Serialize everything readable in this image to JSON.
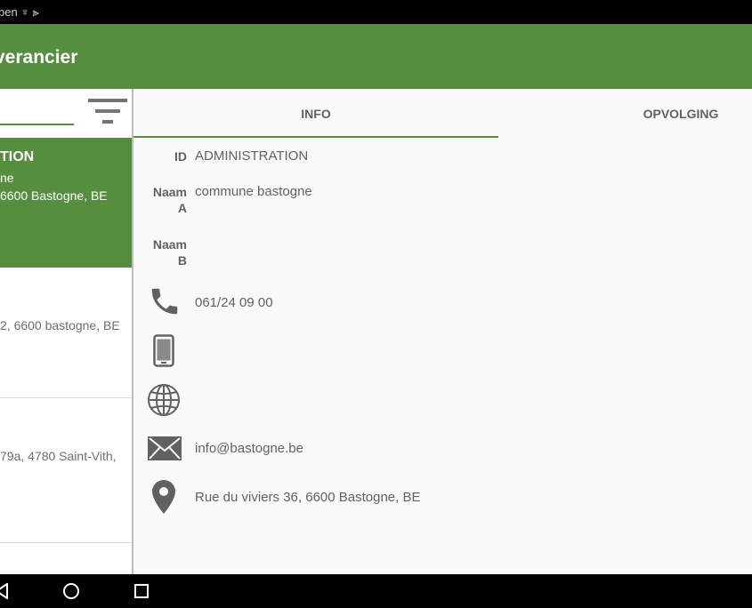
{
  "statusbar": {
    "text": "pen ♆ ⫸"
  },
  "appbar": {
    "title": "verancier"
  },
  "list": {
    "selected": {
      "title": "TION",
      "line2": "ne",
      "line3": "6600 Bastogne, BE"
    },
    "item2": {
      "line": "2, 6600 bastogne, BE"
    },
    "item3": {
      "line": "79a, 4780 Saint-Vith,"
    }
  },
  "tabs": [
    {
      "label": "INFO"
    },
    {
      "label": "OPVOLGING"
    }
  ],
  "details": {
    "id_label": "ID",
    "id_value": "ADMINISTRATION",
    "naam_a_label": "Naam",
    "naam_a_suffix": "A",
    "naam_a_value": "commune bastogne",
    "naam_b_label": "Naam",
    "naam_b_suffix": "B",
    "phone": "061/24 09 00",
    "email": "info@bastogne.be",
    "address": "Rue du viviers 36, 6600 Bastogne, BE"
  },
  "colors": {
    "accent": "#568e3f",
    "text": "#616161"
  },
  "icons": [
    "filter-icon",
    "phone-icon",
    "mobile-icon",
    "globe-icon",
    "mail-icon",
    "location-pin-icon",
    "back-icon",
    "home-icon",
    "recents-icon"
  ]
}
